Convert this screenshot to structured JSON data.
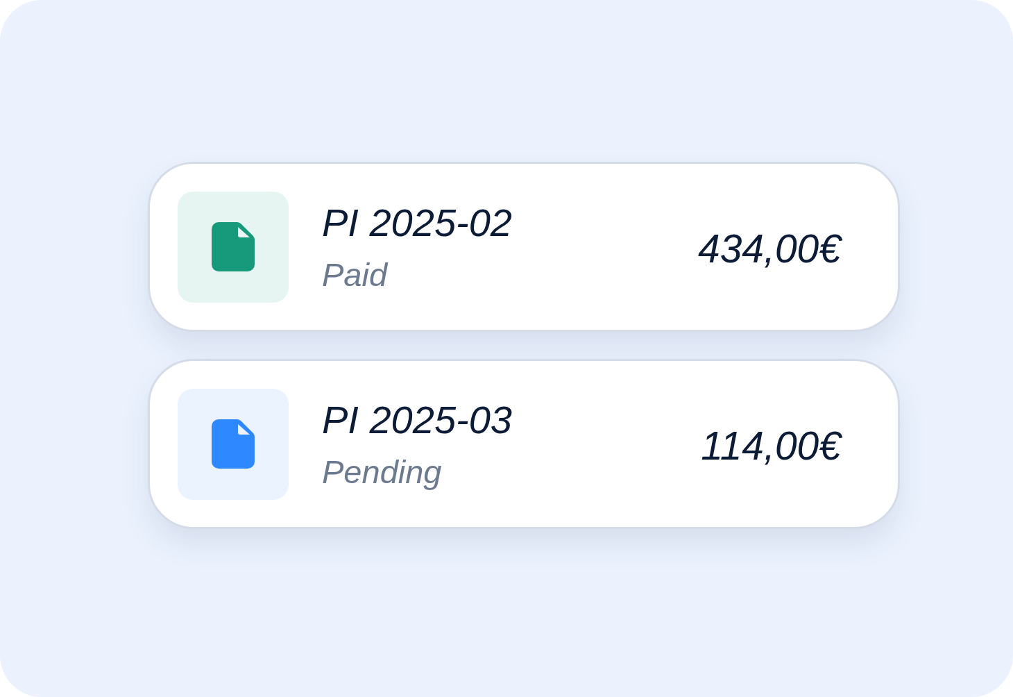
{
  "invoices": [
    {
      "number": "PI 2025-02",
      "status": "Paid",
      "amount": "434,00€",
      "color": "#17997c"
    },
    {
      "number": "PI 2025-03",
      "status": "Pending",
      "amount": "114,00€",
      "color": "#2e88ff"
    }
  ]
}
